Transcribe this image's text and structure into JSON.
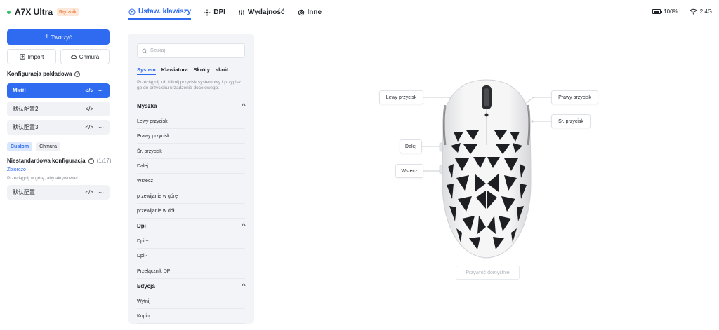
{
  "app": {
    "device_name": "A7X Ultra",
    "device_tag": "Ręcznik",
    "status_color": "#36c06a",
    "accent": "#2f6bf0"
  },
  "sidebar": {
    "create_label": "Tworzyć",
    "import_label": "Import",
    "cloud_label": "Chmura",
    "onboard_title": "Konfiguracja pokładowa",
    "onboard_items": [
      {
        "label": "Matti",
        "active": true
      },
      {
        "label": "默认配置2",
        "active": false
      },
      {
        "label": "默认配置3",
        "active": false
      }
    ],
    "filter_pills": [
      {
        "label": "Custom",
        "active": true
      },
      {
        "label": "Chmura",
        "active": false
      }
    ],
    "custom_title": "Niestandardowa konfiguracja",
    "custom_count": "(1/17)",
    "collapse_link": "Zbiorczo",
    "drag_hint": "Przeciągnij w górę, aby aktywować",
    "custom_items": [
      {
        "label": "默认配置"
      }
    ]
  },
  "topnav": {
    "tabs": [
      {
        "label": "Ustaw. klawiszy",
        "icon": "keyboard-settings-icon",
        "active": true
      },
      {
        "label": "DPI",
        "icon": "dpi-crosshair-icon",
        "active": false
      },
      {
        "label": "Wydajność",
        "icon": "performance-sliders-icon",
        "active": false
      },
      {
        "label": "Inne",
        "icon": "gear-icon",
        "active": false
      }
    ],
    "battery": "100%",
    "connection": "2.4G"
  },
  "keys_panel": {
    "search_placeholder": "Szukaj",
    "tabs": [
      {
        "label": "System",
        "active": true
      },
      {
        "label": "Klawiatura",
        "active": false
      },
      {
        "label": "Skróty",
        "active": false
      },
      {
        "label": "skrót",
        "active": false
      }
    ],
    "description": "Przeciągnij lub kliknij przycisk systemowy i przypisz go do przycisku urządzenia docelowego.",
    "groups": [
      {
        "title": "Myszka",
        "items": [
          "Lewy przycisk",
          "Prawy przycisk",
          "Śr. przycisk",
          "Dalej",
          "Wstecz",
          "przewijanie w górę",
          "przewijanie w dół"
        ]
      },
      {
        "title": "Dpi",
        "items": [
          "Dpi +",
          "Dpi -",
          "Przełącznik DPI"
        ]
      },
      {
        "title": "Edycja",
        "items": [
          "Wytnij",
          "Kopiuj"
        ]
      }
    ]
  },
  "mouse": {
    "callouts": {
      "left": "Lewy przycisk",
      "right": "Prawy przycisk",
      "middle": "Śr. przycisk",
      "forward": "Dalej",
      "back": "Wstecz"
    },
    "restore_label": "Przywróć domyślnie"
  }
}
